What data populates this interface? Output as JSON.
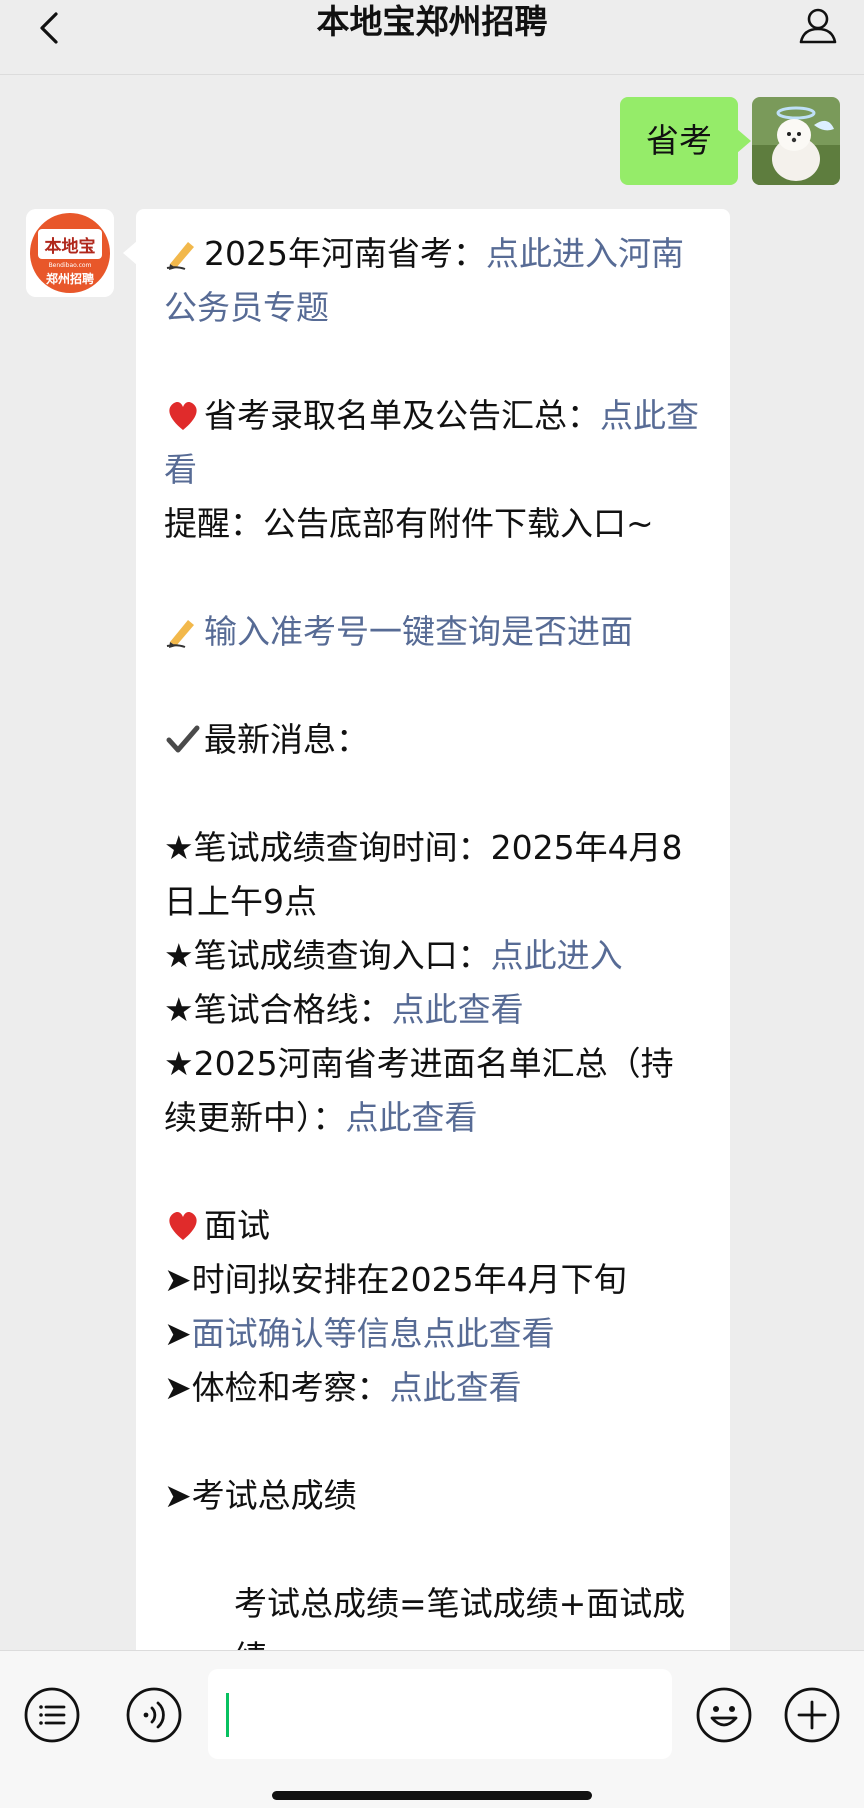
{
  "header": {
    "title": "本地宝郑州招聘",
    "back_icon": "chevron-left-icon",
    "profile_icon": "person-icon"
  },
  "user_message": {
    "text": "省考",
    "avatar": "dog-avatar"
  },
  "bot_avatar": {
    "brand": "本地宝",
    "domain": "Bendibao.com",
    "sub": "郑州招聘",
    "accent": "#e8572a"
  },
  "bot_message": {
    "lines": [
      {
        "emoji": "✍",
        "segments": [
          {
            "t": "2025年河南省考：",
            "link": false
          },
          {
            "t": "点此进入河南公务员专题",
            "link": true
          }
        ]
      },
      {
        "blank": true
      },
      {
        "emoji": "❤",
        "segments": [
          {
            "t": "省考录取名单及公告汇总：",
            "link": false
          },
          {
            "t": "点此查看",
            "link": true
          }
        ]
      },
      {
        "segments": [
          {
            "t": "提醒：公告底部有附件下载入口~",
            "link": false
          }
        ]
      },
      {
        "blank": true
      },
      {
        "emoji": "✍",
        "segments": [
          {
            "t": "输入准考号一键查询是否进面",
            "link": true
          }
        ]
      },
      {
        "blank": true
      },
      {
        "emoji": "✔",
        "segments": [
          {
            "t": "最新消息：",
            "link": false
          }
        ]
      },
      {
        "blank": true
      },
      {
        "segments": [
          {
            "t": "★笔试成绩查询时间：2025年4月8日上午9点",
            "link": false
          }
        ]
      },
      {
        "segments": [
          {
            "t": "★笔试成绩查询入口：",
            "link": false
          },
          {
            "t": "点此进入",
            "link": true
          }
        ]
      },
      {
        "segments": [
          {
            "t": "★笔试合格线：",
            "link": false
          },
          {
            "t": "点此查看",
            "link": true
          }
        ]
      },
      {
        "segments": [
          {
            "t": "★2025河南省考进面名单汇总（持续更新中）：",
            "link": false
          },
          {
            "t": "点此查看",
            "link": true
          }
        ]
      },
      {
        "blank": true
      },
      {
        "emoji": "❤",
        "segments": [
          {
            "t": "面试",
            "link": false
          }
        ]
      },
      {
        "segments": [
          {
            "t": "➤时间拟安排在2025年4月下旬",
            "link": false
          }
        ]
      },
      {
        "segments": [
          {
            "t": "➤",
            "link": false
          },
          {
            "t": "面试确认等信息点此查看",
            "link": true
          }
        ]
      },
      {
        "segments": [
          {
            "t": "➤体检和考察：",
            "link": false
          },
          {
            "t": "点此查看",
            "link": true
          }
        ]
      },
      {
        "blank": true
      },
      {
        "segments": [
          {
            "t": "➤考试总成绩",
            "link": false
          }
        ]
      },
      {
        "blank": true
      },
      {
        "indent": true,
        "segments": [
          {
            "t": "考试总成绩=笔试成绩+面试成绩",
            "link": false
          }
        ]
      }
    ],
    "link_color": "#576b95"
  },
  "input_bar": {
    "list_icon": "list-icon",
    "voice_icon": "voice-icon",
    "emoji_icon": "smiley-icon",
    "add_icon": "plus-icon",
    "message_value": ""
  },
  "colors": {
    "background": "#ededed",
    "user_bubble": "#95ec69",
    "bot_bubble": "#ffffff",
    "cursor": "#07c160"
  }
}
